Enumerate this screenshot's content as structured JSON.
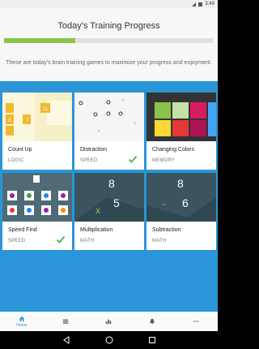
{
  "status_bar": {
    "time": "3:49"
  },
  "header": {
    "title": "Today's Training Progress",
    "progress": 0.34,
    "subtitle": "These are today's brain training games to maximize your progress and enjoyment."
  },
  "games": [
    {
      "name": "Count Up",
      "category": "LOGIC",
      "completed": false
    },
    {
      "name": "Distraction",
      "category": "SPEED",
      "completed": true
    },
    {
      "name": "Changing Colors",
      "category": "MEMORY",
      "completed": false
    },
    {
      "name": "Speed Find",
      "category": "SPEED",
      "completed": true
    },
    {
      "name": "Multiplication",
      "category": "MATH",
      "completed": false
    },
    {
      "name": "Subtraction",
      "category": "MATH",
      "completed": false
    }
  ],
  "art": {
    "count_up": [
      "7",
      "11",
      "3"
    ],
    "multiplication": [
      "8",
      "5",
      "x"
    ],
    "subtraction": [
      "8",
      "6",
      "-"
    ]
  },
  "bottom_nav": [
    {
      "label": "Home",
      "icon": "home-icon",
      "active": true
    },
    {
      "label": "",
      "icon": "list-icon",
      "active": false
    },
    {
      "label": "",
      "icon": "bar-chart-icon",
      "active": false
    },
    {
      "label": "",
      "icon": "bell-icon",
      "active": false
    },
    {
      "label": "",
      "icon": "more-icon",
      "active": false
    }
  ],
  "colors": {
    "accent": "#2a96d8",
    "progress": "#8bc34a",
    "check": "#4caf50"
  }
}
